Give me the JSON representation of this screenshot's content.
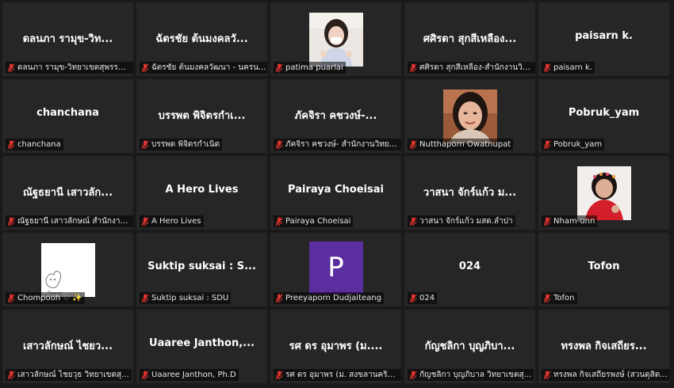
{
  "colors": {
    "tile_background": "#262626",
    "window_background": "#1a1a1a",
    "mic_muted": "#e0342f",
    "avatar_purple": "#5b2e9f"
  },
  "participants": [
    {
      "title": "ดลนภา รามุข-วิท...",
      "label": "ดลนภา รามุข-วิทยาเขตสุพรรณ..."
    },
    {
      "title": "ฉัตรชัย ต้นมงคลวั...",
      "label": "ฉัตรชัย ต้นมงคลวัฒนา - นครน..."
    },
    {
      "title": "",
      "label": "patima puarlai",
      "photo": "photo-girl-mask"
    },
    {
      "title": "ศศิรดา สุกสีเหลือง...",
      "label": "ศศิรดา สุกสีเหลือง-สำนักงานวิท..."
    },
    {
      "title": "paisarn k.",
      "label": "paisarn k."
    },
    {
      "title": "chanchana",
      "label": "chanchana"
    },
    {
      "title": "บรรพต พิจิตรกำเ...",
      "label": "บรรพต พิจิตรกำเนิด"
    },
    {
      "title": "ภัคจิรา คชวงษ์-...",
      "label": "ภัคจิรา คชวงษ์- สำนักงานวิทยาเขต..."
    },
    {
      "title": "",
      "label": "Nutthaporn Owatnupat",
      "photo": "photo-woman"
    },
    {
      "title": "Pobruk_yam",
      "label": "Pobruk_yam"
    },
    {
      "title": "ณัฐธยานี เสาวลัก...",
      "label": "ณัฐธยานี เสาวลักษณ์ สำนักงาน..."
    },
    {
      "title": "A Hero Lives",
      "label": "A Hero Lives"
    },
    {
      "title": "Pairaya Choeisai",
      "label": "Pairaya Choeisai"
    },
    {
      "title": "วาสนา จักร์แก้ว ม...",
      "label": "วาสนา จักร์แก้ว มสด.ลำปา"
    },
    {
      "title": "",
      "label": "Nham-unn",
      "photo": "photo-girl-red"
    },
    {
      "title": "",
      "label": "Chompooh",
      "photo": "photo-sketch",
      "heart": "♡ ✨"
    },
    {
      "title": "Suktip suksai : S...",
      "label": "Suktip suksai : SDU"
    },
    {
      "title": "",
      "label": "Preeyaporn Dudjaiteang",
      "avatar_letter": "P"
    },
    {
      "title": "024",
      "label": "024"
    },
    {
      "title": "Tofon",
      "label": "Tofon"
    },
    {
      "title": "เสาวลักษณ์ ไชยว...",
      "label": "เสาวลักษณ์ ไชยวุธ วิทยาเขตสุ..."
    },
    {
      "title": "Uaaree Janthon,...",
      "label": "Uaaree Janthon, Ph.D"
    },
    {
      "title": "รศ ดร อุมาพร (ม....",
      "label": "รศ ดร อุมาพร (ม. สงขลานครินทร์..."
    },
    {
      "title": "กัญชลิกา บุญภิบา...",
      "label": "กัญชลิกา บุญภิบาล วิทยาเขตสุ..."
    },
    {
      "title": "ทรงพล กิจเสถียร...",
      "label": "ทรงพล กิจเสถียรพงษ์ (สวนดุสิต..."
    }
  ]
}
